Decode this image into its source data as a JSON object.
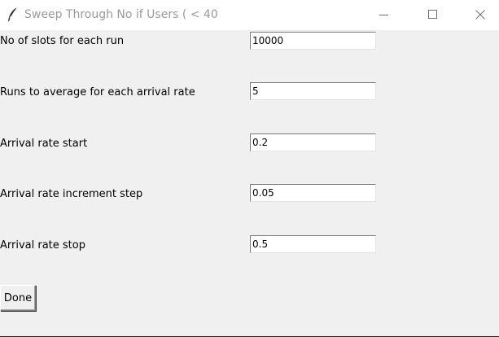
{
  "window": {
    "title": "Sweep Through No if Users ( < 40",
    "app_icon": "feather-icon",
    "controls": {
      "minimize_icon": "minimize-icon",
      "maximize_icon": "maximize-icon",
      "close_icon": "close-icon"
    }
  },
  "form": {
    "fields": [
      {
        "label": "No of slots for each run",
        "value": "10000"
      },
      {
        "label": "Runs to average for each arrival rate",
        "value": "5"
      },
      {
        "label": "Arrival rate start",
        "value": "0.2"
      },
      {
        "label": "Arrival rate increment step",
        "value": "0.05"
      },
      {
        "label": "Arrival rate stop",
        "value": "0.5"
      }
    ],
    "done_label": "Done"
  },
  "colors": {
    "background": "#f0f0f0",
    "titlebar": "#ffffff",
    "title_text": "#9a9a9a",
    "entry_bg": "#ffffff"
  }
}
